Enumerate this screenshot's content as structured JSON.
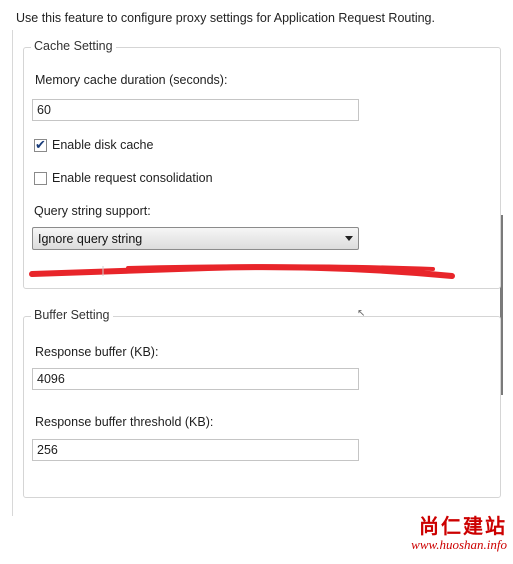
{
  "description": "Use this feature to configure proxy settings for Application Request Routing.",
  "cache_setting": {
    "legend": "Cache Setting",
    "memory_duration_label": "Memory cache duration (seconds):",
    "memory_duration_value": "60",
    "disk_cache_label": "Enable disk cache",
    "disk_cache_checked": true,
    "request_consolidation_label": "Enable request consolidation",
    "request_consolidation_checked": false,
    "query_string_label": "Query string support:",
    "query_string_value": "Ignore query string"
  },
  "buffer_setting": {
    "legend": "Buffer Setting",
    "response_buffer_label": "Response buffer (KB):",
    "response_buffer_value": "4096",
    "response_buffer_threshold_label": "Response buffer threshold (KB):",
    "response_buffer_threshold_value": "256"
  },
  "watermark": {
    "chinese": "尚仁建站",
    "url": "www.huoshan.info"
  },
  "colors": {
    "watermark": "#cc0000",
    "redaction": "#e8252a"
  }
}
